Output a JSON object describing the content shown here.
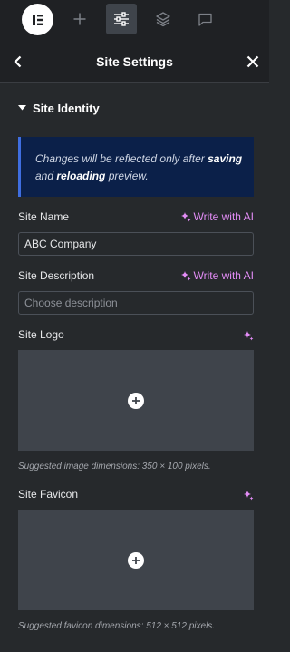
{
  "toolbar": {
    "icons": [
      "elementor-logo-icon",
      "add-element-icon",
      "site-settings-icon",
      "layers-icon",
      "comments-icon"
    ]
  },
  "header": {
    "title": "Site Settings"
  },
  "section": {
    "title": "Site Identity"
  },
  "notice": {
    "part1": "Changes will be reflected only after ",
    "bold1": "saving",
    "part2": " and ",
    "bold2": "reloading",
    "part3": " preview."
  },
  "site_name": {
    "label": "Site Name",
    "ai_label": "Write with AI",
    "value": "ABC Company"
  },
  "site_description": {
    "label": "Site Description",
    "ai_label": "Write with AI",
    "placeholder": "Choose description"
  },
  "site_logo": {
    "label": "Site Logo",
    "hint": "Suggested image dimensions: 350 × 100 pixels."
  },
  "site_favicon": {
    "label": "Site Favicon",
    "hint": "Suggested favicon dimensions: 512 × 512 pixels."
  },
  "colors": {
    "ai_accent": "#e28cf5",
    "notice_bg": "#0b2049",
    "notice_border": "#3f6ee0",
    "panel_bg": "#26292c"
  }
}
